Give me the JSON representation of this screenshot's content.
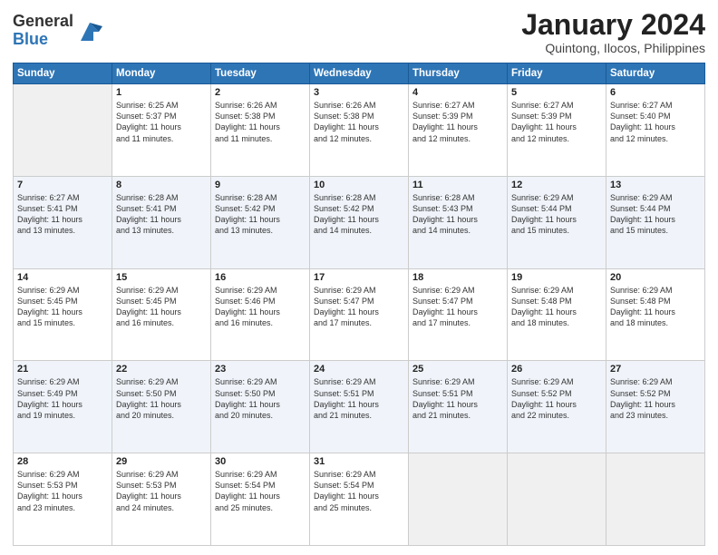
{
  "header": {
    "logo_general": "General",
    "logo_blue": "Blue",
    "month_title": "January 2024",
    "location": "Quintong, Ilocos, Philippines"
  },
  "weekdays": [
    "Sunday",
    "Monday",
    "Tuesday",
    "Wednesday",
    "Thursday",
    "Friday",
    "Saturday"
  ],
  "weeks": [
    [
      {
        "day": "",
        "info": ""
      },
      {
        "day": "1",
        "info": "Sunrise: 6:25 AM\nSunset: 5:37 PM\nDaylight: 11 hours\nand 11 minutes."
      },
      {
        "day": "2",
        "info": "Sunrise: 6:26 AM\nSunset: 5:38 PM\nDaylight: 11 hours\nand 11 minutes."
      },
      {
        "day": "3",
        "info": "Sunrise: 6:26 AM\nSunset: 5:38 PM\nDaylight: 11 hours\nand 12 minutes."
      },
      {
        "day": "4",
        "info": "Sunrise: 6:27 AM\nSunset: 5:39 PM\nDaylight: 11 hours\nand 12 minutes."
      },
      {
        "day": "5",
        "info": "Sunrise: 6:27 AM\nSunset: 5:39 PM\nDaylight: 11 hours\nand 12 minutes."
      },
      {
        "day": "6",
        "info": "Sunrise: 6:27 AM\nSunset: 5:40 PM\nDaylight: 11 hours\nand 12 minutes."
      }
    ],
    [
      {
        "day": "7",
        "info": "Sunrise: 6:27 AM\nSunset: 5:41 PM\nDaylight: 11 hours\nand 13 minutes."
      },
      {
        "day": "8",
        "info": "Sunrise: 6:28 AM\nSunset: 5:41 PM\nDaylight: 11 hours\nand 13 minutes."
      },
      {
        "day": "9",
        "info": "Sunrise: 6:28 AM\nSunset: 5:42 PM\nDaylight: 11 hours\nand 13 minutes."
      },
      {
        "day": "10",
        "info": "Sunrise: 6:28 AM\nSunset: 5:42 PM\nDaylight: 11 hours\nand 14 minutes."
      },
      {
        "day": "11",
        "info": "Sunrise: 6:28 AM\nSunset: 5:43 PM\nDaylight: 11 hours\nand 14 minutes."
      },
      {
        "day": "12",
        "info": "Sunrise: 6:29 AM\nSunset: 5:44 PM\nDaylight: 11 hours\nand 15 minutes."
      },
      {
        "day": "13",
        "info": "Sunrise: 6:29 AM\nSunset: 5:44 PM\nDaylight: 11 hours\nand 15 minutes."
      }
    ],
    [
      {
        "day": "14",
        "info": "Sunrise: 6:29 AM\nSunset: 5:45 PM\nDaylight: 11 hours\nand 15 minutes."
      },
      {
        "day": "15",
        "info": "Sunrise: 6:29 AM\nSunset: 5:45 PM\nDaylight: 11 hours\nand 16 minutes."
      },
      {
        "day": "16",
        "info": "Sunrise: 6:29 AM\nSunset: 5:46 PM\nDaylight: 11 hours\nand 16 minutes."
      },
      {
        "day": "17",
        "info": "Sunrise: 6:29 AM\nSunset: 5:47 PM\nDaylight: 11 hours\nand 17 minutes."
      },
      {
        "day": "18",
        "info": "Sunrise: 6:29 AM\nSunset: 5:47 PM\nDaylight: 11 hours\nand 17 minutes."
      },
      {
        "day": "19",
        "info": "Sunrise: 6:29 AM\nSunset: 5:48 PM\nDaylight: 11 hours\nand 18 minutes."
      },
      {
        "day": "20",
        "info": "Sunrise: 6:29 AM\nSunset: 5:48 PM\nDaylight: 11 hours\nand 18 minutes."
      }
    ],
    [
      {
        "day": "21",
        "info": "Sunrise: 6:29 AM\nSunset: 5:49 PM\nDaylight: 11 hours\nand 19 minutes."
      },
      {
        "day": "22",
        "info": "Sunrise: 6:29 AM\nSunset: 5:50 PM\nDaylight: 11 hours\nand 20 minutes."
      },
      {
        "day": "23",
        "info": "Sunrise: 6:29 AM\nSunset: 5:50 PM\nDaylight: 11 hours\nand 20 minutes."
      },
      {
        "day": "24",
        "info": "Sunrise: 6:29 AM\nSunset: 5:51 PM\nDaylight: 11 hours\nand 21 minutes."
      },
      {
        "day": "25",
        "info": "Sunrise: 6:29 AM\nSunset: 5:51 PM\nDaylight: 11 hours\nand 21 minutes."
      },
      {
        "day": "26",
        "info": "Sunrise: 6:29 AM\nSunset: 5:52 PM\nDaylight: 11 hours\nand 22 minutes."
      },
      {
        "day": "27",
        "info": "Sunrise: 6:29 AM\nSunset: 5:52 PM\nDaylight: 11 hours\nand 23 minutes."
      }
    ],
    [
      {
        "day": "28",
        "info": "Sunrise: 6:29 AM\nSunset: 5:53 PM\nDaylight: 11 hours\nand 23 minutes."
      },
      {
        "day": "29",
        "info": "Sunrise: 6:29 AM\nSunset: 5:53 PM\nDaylight: 11 hours\nand 24 minutes."
      },
      {
        "day": "30",
        "info": "Sunrise: 6:29 AM\nSunset: 5:54 PM\nDaylight: 11 hours\nand 25 minutes."
      },
      {
        "day": "31",
        "info": "Sunrise: 6:29 AM\nSunset: 5:54 PM\nDaylight: 11 hours\nand 25 minutes."
      },
      {
        "day": "",
        "info": ""
      },
      {
        "day": "",
        "info": ""
      },
      {
        "day": "",
        "info": ""
      }
    ]
  ]
}
